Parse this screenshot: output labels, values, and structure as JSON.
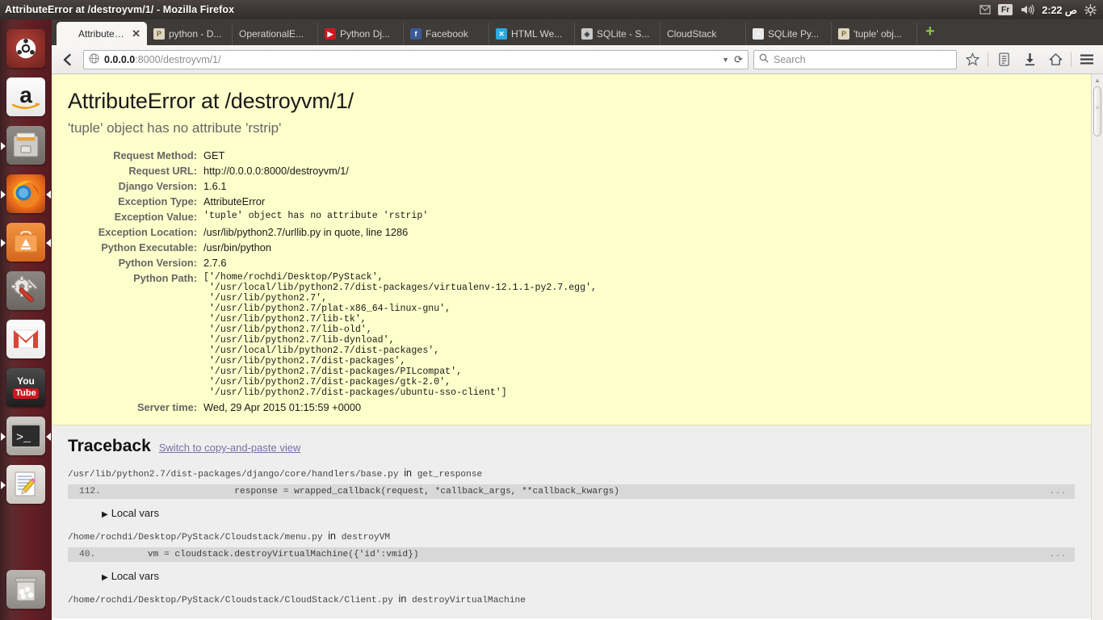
{
  "desktop": {
    "window_title": "AttributeError at /destroyvm/1/ - Mozilla Firefox",
    "tray": {
      "message_icon": "envelope-icon",
      "keyboard_layout": "Fr",
      "volume_icon": "volume-icon",
      "clock": "ص 2:22",
      "session_icon": "gear-icon"
    },
    "launcher": [
      {
        "name": "ubuntu-dash",
        "label": "Ubuntu Dash",
        "icon": "ubuntu-logo-icon",
        "running": false,
        "focused": false
      },
      {
        "name": "amazon",
        "label": "Amazon",
        "icon": "amazon-icon",
        "running": false,
        "focused": false
      },
      {
        "name": "files",
        "label": "Files",
        "icon": "file-manager-icon",
        "running": true,
        "focused": false
      },
      {
        "name": "firefox",
        "label": "Firefox Web Browser",
        "icon": "firefox-icon",
        "running": true,
        "focused": true
      },
      {
        "name": "ubuntu-software-center",
        "label": "Ubuntu Software Center",
        "icon": "software-center-icon",
        "running": true,
        "focused": false
      },
      {
        "name": "system-settings",
        "label": "System Settings",
        "icon": "settings-icon",
        "running": false,
        "focused": false
      },
      {
        "name": "gmail",
        "label": "Gmail",
        "icon": "gmail-icon",
        "running": false,
        "focused": false
      },
      {
        "name": "youtube",
        "label": "YouTube",
        "icon": "youtube-icon",
        "running": false,
        "focused": false
      },
      {
        "name": "terminal",
        "label": "Terminal",
        "icon": "terminal-icon",
        "running": true,
        "focused": false
      },
      {
        "name": "text-editor",
        "label": "Text Editor",
        "icon": "text-editor-icon",
        "running": true,
        "focused": false
      }
    ],
    "trash": {
      "name": "trash",
      "label": "Trash",
      "icon": "trash-icon"
    }
  },
  "browser": {
    "tabs": [
      {
        "label": "AttributeE...",
        "favicon": "none",
        "active": true,
        "close_label": "✕"
      },
      {
        "label": "python - D...",
        "favicon": "py",
        "active": false
      },
      {
        "label": "OperationalE...",
        "favicon": "none",
        "active": false
      },
      {
        "label": "Python Dj...",
        "favicon": "yt",
        "active": false
      },
      {
        "label": "Facebook",
        "favicon": "fb",
        "active": false
      },
      {
        "label": "HTML We...",
        "favicon": "html",
        "active": false
      },
      {
        "label": "SQLite - S...",
        "favicon": "sq",
        "active": false
      },
      {
        "label": "CloudStack",
        "favicon": "none",
        "active": false
      },
      {
        "label": "SQLite Py...",
        "favicon": "sqpy",
        "active": false
      },
      {
        "label": "'tuple' obj...",
        "favicon": "py",
        "active": false
      }
    ],
    "new_tab_label": "+",
    "nav": {
      "back_icon": "back-arrow-icon",
      "url_host": "0.0.0.0",
      "url_rest": ":8000/destroyvm/1/",
      "url_full": "0.0.0.0:8000/destroyvm/1/",
      "identity_icon": "globe-icon",
      "dropdown_icon": "chevron-down-icon",
      "reload_icon": "reload-icon",
      "search_placeholder": "Search",
      "search_value": "",
      "search_icon": "search-icon",
      "bookmark_icon": "star-icon",
      "reader_icon": "reading-list-icon",
      "downloads_icon": "download-arrow-icon",
      "home_icon": "home-icon",
      "menu_icon": "hamburger-menu-icon"
    }
  },
  "page": {
    "heading": "AttributeError at /destroyvm/1/",
    "subheading": "'tuple' object has no attribute 'rstrip'",
    "meta": [
      {
        "label": "Request Method:",
        "value": "GET",
        "mono": false
      },
      {
        "label": "Request URL:",
        "value": "http://0.0.0.0:8000/destroyvm/1/",
        "mono": false
      },
      {
        "label": "Django Version:",
        "value": "1.6.1",
        "mono": false
      },
      {
        "label": "Exception Type:",
        "value": "AttributeError",
        "mono": false
      },
      {
        "label": "Exception Value:",
        "value": "'tuple' object has no attribute 'rstrip'",
        "mono": true
      },
      {
        "label": "Exception Location:",
        "value": "/usr/lib/python2.7/urllib.py in quote, line 1286",
        "mono": false
      },
      {
        "label": "Python Executable:",
        "value": "/usr/bin/python",
        "mono": false
      },
      {
        "label": "Python Version:",
        "value": "2.7.6",
        "mono": false
      }
    ],
    "python_path_label": "Python Path:",
    "python_path": "['/home/rochdi/Desktop/PyStack',\n '/usr/local/lib/python2.7/dist-packages/virtualenv-12.1.1-py2.7.egg',\n '/usr/lib/python2.7',\n '/usr/lib/python2.7/plat-x86_64-linux-gnu',\n '/usr/lib/python2.7/lib-tk',\n '/usr/lib/python2.7/lib-old',\n '/usr/lib/python2.7/lib-dynload',\n '/usr/local/lib/python2.7/dist-packages',\n '/usr/lib/python2.7/dist-packages',\n '/usr/lib/python2.7/dist-packages/PILcompat',\n '/usr/lib/python2.7/dist-packages/gtk-2.0',\n '/usr/lib/python2.7/dist-packages/ubuntu-sso-client']",
    "server_time_label": "Server time:",
    "server_time": "Wed, 29 Apr 2015 01:15:59 +0000",
    "traceback": {
      "title": "Traceback",
      "switch_link": "Switch to copy-and-paste view",
      "frames": [
        {
          "file": "/usr/lib/python2.7/dist-packages/django/core/handlers/base.py",
          "in_word": "in",
          "function": "get_response",
          "line_number": "112.",
          "code": "                    response = wrapped_callback(request, *callback_args, **callback_kwargs)",
          "ellipsis": "...",
          "local_vars_label": "Local vars"
        },
        {
          "file": "/home/rochdi/Desktop/PyStack/Cloudstack/menu.py",
          "in_word": "in",
          "function": "destroyVM",
          "line_number": "40.",
          "code": "    vm = cloudstack.destroyVirtualMachine({'id':vmid})",
          "ellipsis": "...",
          "local_vars_label": "Local vars"
        },
        {
          "file": "/home/rochdi/Desktop/PyStack/Cloudstack/CloudStack/Client.py",
          "in_word": "in",
          "function": "destroyVirtualMachine",
          "line_number": "",
          "code": "",
          "ellipsis": "",
          "local_vars_label": ""
        }
      ]
    }
  },
  "colors": {
    "summary_bg": "#ffffcc",
    "traceback_bg": "#eeeeee",
    "link": "#7a6fa8",
    "launcher_bg": "#5d2b2e",
    "panel_bg": "#3c3634"
  }
}
